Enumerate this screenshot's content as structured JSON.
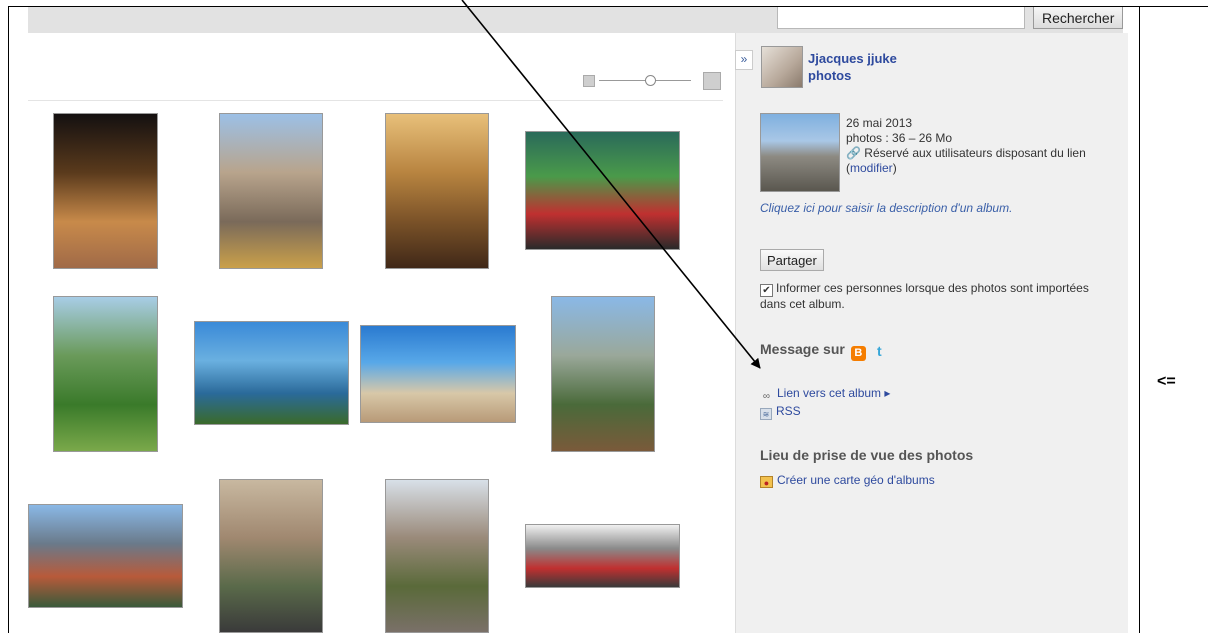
{
  "search": {
    "value": "",
    "button_label": "Rechercher"
  },
  "sidebar": {
    "collapse_glyph": "»",
    "owner_name": "Jjacques jjuke",
    "owner_photos_label": "photos",
    "album_date": "26 mai 2013",
    "album_stats": "photos : 36 – 26 Mo",
    "visibility_text": "Réservé aux utilisateurs disposant du lien",
    "modify_link": "modifier",
    "description_prompt": "Cliquez ici pour saisir la description d'un album.",
    "share_button": "Partager",
    "notify_checked": true,
    "notify_text": "Informer ces personnes lorsque des photos sont importées dans cet album.",
    "message_title": "Message sur",
    "album_link": "Lien vers cet album",
    "rss_link": "RSS",
    "geo_title": "Lieu de prise de vue des photos",
    "geo_link": "Créer une carte géo d'albums"
  },
  "annotation": {
    "label": "<="
  },
  "icons": {
    "zoom_small": "person-small-icon",
    "zoom_large": "person-large-icon",
    "visibility": "link-globe-icon",
    "album_link": "chain-link-icon",
    "rss": "rss-icon",
    "geo": "map-icon",
    "blogger": "blogger-icon",
    "twitter": "twitter-icon"
  },
  "photos": [
    {
      "id": "porto-night-street",
      "colors": [
        "#141010",
        "#5a3a1c",
        "#c88a4a",
        "#a06a48"
      ]
    },
    {
      "id": "porto-tram-street",
      "colors": [
        "#9cc0e6",
        "#b8a48c",
        "#7a6a5a",
        "#caa04a"
      ]
    },
    {
      "id": "church-gold-ceiling",
      "colors": [
        "#e8c07a",
        "#b88440",
        "#7a5228",
        "#402818"
      ]
    },
    {
      "id": "casa-oriental-shop",
      "colors": [
        "#2a6a5a",
        "#4a9a4a",
        "#c03030",
        "#2a2a2a"
      ]
    },
    {
      "id": "douro-garden-view",
      "colors": [
        "#a8cde6",
        "#6a9a5a",
        "#3a7a2a",
        "#7aa84a"
      ]
    },
    {
      "id": "coast-rocks",
      "colors": [
        "#3a8ad8",
        "#6ab0e0",
        "#2a6a9a",
        "#3a6a2a"
      ]
    },
    {
      "id": "beach-colonnade",
      "colors": [
        "#2a7ad0",
        "#58a8e8",
        "#d8c8a8",
        "#b89a78"
      ]
    },
    {
      "id": "bridge-tram-view",
      "colors": [
        "#8ab8e6",
        "#9aa89a",
        "#4a6a3a",
        "#7a5a3a"
      ]
    },
    {
      "id": "bridge-river-panorama",
      "colors": [
        "#8ab8e6",
        "#6a7a8a",
        "#b85a3a",
        "#3a5a3a"
      ]
    },
    {
      "id": "narrow-alley-laundry",
      "colors": [
        "#c8b8a0",
        "#a08870",
        "#5a6a4a",
        "#3a3a3a"
      ]
    },
    {
      "id": "stone-alley-steps",
      "colors": [
        "#d8e0e8",
        "#9a8a7a",
        "#5a6a3a",
        "#7a7068"
      ]
    },
    {
      "id": "scooters-parked",
      "colors": [
        "#f0f0f0",
        "#8a8a8a",
        "#c03030",
        "#3a3a3a"
      ]
    }
  ]
}
